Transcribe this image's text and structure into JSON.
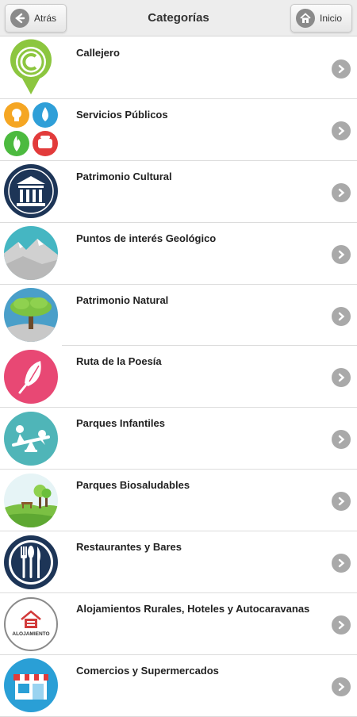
{
  "header": {
    "title": "Categorías",
    "back_label": "Atrás",
    "home_label": "Inicio"
  },
  "categories": [
    {
      "label": "Callejero",
      "icon": "map-pin-icon"
    },
    {
      "label": "Servicios Públicos",
      "icon": "public-services-icon"
    },
    {
      "label": "Patrimonio Cultural",
      "icon": "museum-icon"
    },
    {
      "label": "Puntos de interés Geológico",
      "icon": "mountain-icon"
    },
    {
      "label": "Patrimonio Natural",
      "icon": "tree-icon"
    },
    {
      "label": "Ruta de la Poesía",
      "icon": "feather-icon"
    },
    {
      "label": "Parques Infantiles",
      "icon": "seesaw-icon"
    },
    {
      "label": "Parques Biosaludables",
      "icon": "park-icon"
    },
    {
      "label": "Restaurantes y Bares",
      "icon": "cutlery-icon"
    },
    {
      "label": "Alojamientos Rurales, Hoteles y Autocaravanas",
      "icon": "lodging-icon",
      "icon_text": "ALOJAMIENTO"
    },
    {
      "label": "Comercios y Supermercados",
      "icon": "shop-icon"
    }
  ],
  "colors": {
    "header_bg": "#ededed",
    "arrow": "#a9a9a9",
    "callejero": "#8cc63f",
    "museum": "#1d3557",
    "geology": "#45b6c2",
    "nature": "#4a9fc9",
    "poetry": "#e84874",
    "playground": "#4fb5b8",
    "park": "#7bc043",
    "restaurant": "#1d3557",
    "shop": "#2a9fd6"
  }
}
